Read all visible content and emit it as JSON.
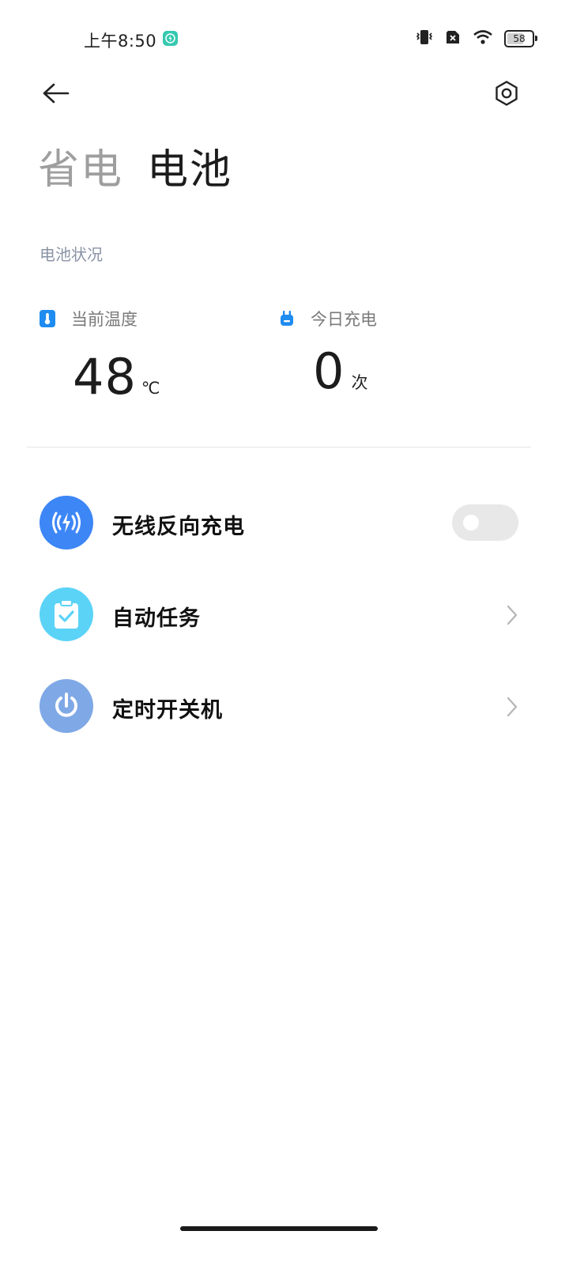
{
  "status_bar": {
    "time": "上午8:50",
    "battery_level": "58",
    "icons": [
      "charging-app-icon",
      "vibrate-icon",
      "sim-off-icon",
      "wifi-icon",
      "battery-icon"
    ]
  },
  "header": {
    "tabs": [
      {
        "label": "省电",
        "active": false
      },
      {
        "label": "电池",
        "active": true
      }
    ]
  },
  "battery_status": {
    "section_title": "电池状况",
    "temperature": {
      "label": "当前温度",
      "value": "48",
      "unit": "℃"
    },
    "charges_today": {
      "label": "今日充电",
      "value": "0",
      "unit": "次"
    }
  },
  "menu": {
    "items": [
      {
        "label": "无线反向充电",
        "icon": "wireless-charging-icon",
        "icon_bg": "#3d86f6",
        "control": "toggle",
        "toggle_on": false
      },
      {
        "label": "自动任务",
        "icon": "clipboard-check-icon",
        "icon_bg": "#5bd3f7",
        "control": "chevron"
      },
      {
        "label": "定时开关机",
        "icon": "power-icon",
        "icon_bg": "#7fa8e6",
        "control": "chevron"
      }
    ]
  },
  "colors": {
    "accent_blue": "#1e8cf0",
    "inactive_tab": "#9e9e9e",
    "section_title": "#8a93a6"
  }
}
